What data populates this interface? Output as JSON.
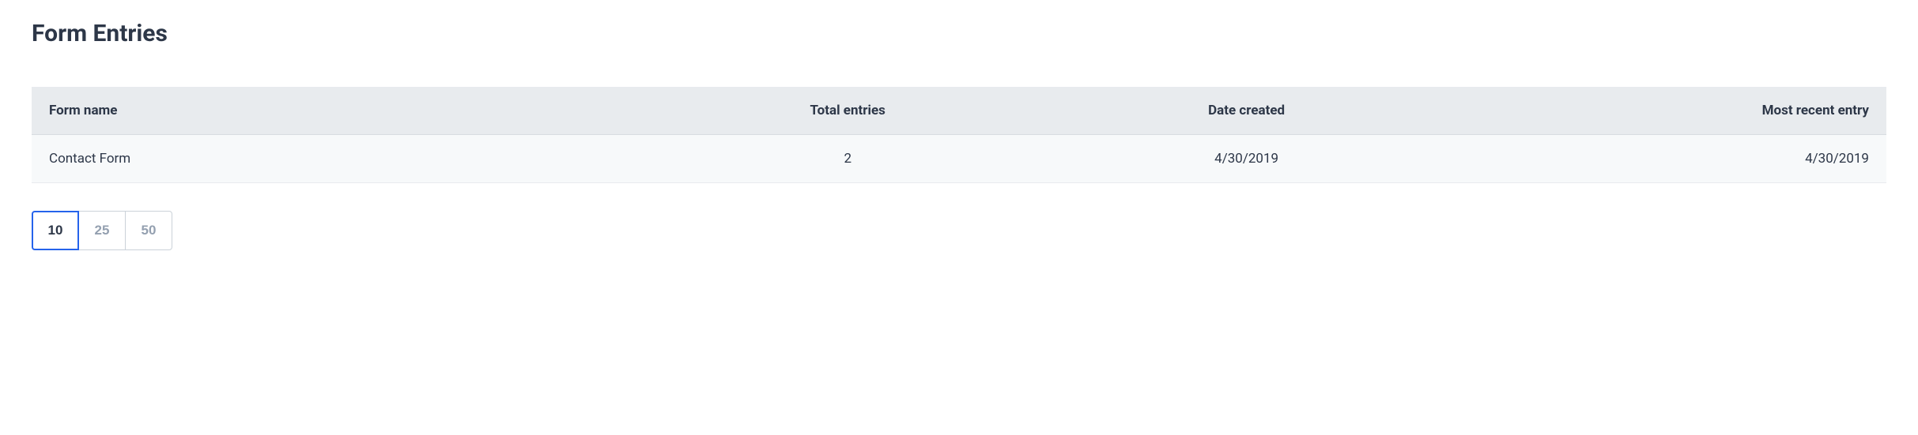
{
  "page": {
    "title": "Form Entries"
  },
  "table": {
    "headers": {
      "form_name": "Form name",
      "total_entries": "Total entries",
      "date_created": "Date created",
      "most_recent": "Most recent entry"
    },
    "rows": [
      {
        "form_name": "Contact Form",
        "total_entries": "2",
        "date_created": "4/30/2019",
        "most_recent": "4/30/2019"
      }
    ]
  },
  "page_size": {
    "options": [
      "10",
      "25",
      "50"
    ],
    "active": "10"
  }
}
